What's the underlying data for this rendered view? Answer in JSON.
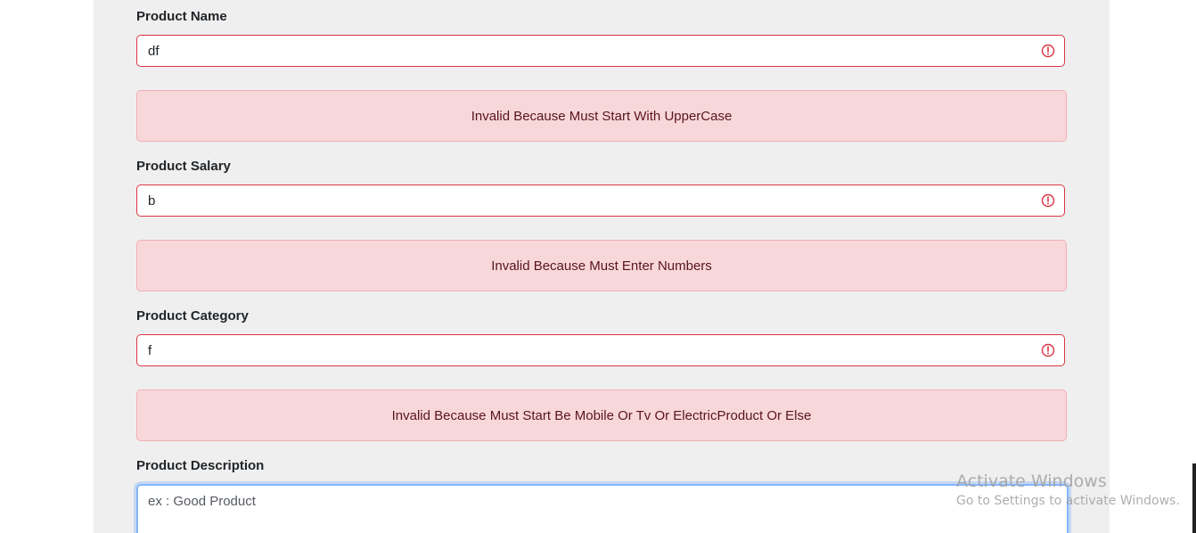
{
  "form": {
    "name": {
      "label": "Product Name",
      "value": "df",
      "error": "Invalid Because Must Start With UpperCase"
    },
    "salary": {
      "label": "Product Salary",
      "value": "b",
      "error": "Invalid Because Must Enter Numbers"
    },
    "category": {
      "label": "Product Category",
      "value": "f",
      "error": "Invalid Because Must Start Be Mobile Or Tv Or ElectricProduct Or Else"
    },
    "description": {
      "label": "Product Description",
      "placeholder": "ex : Good Product"
    }
  },
  "watermark": {
    "title": "Activate Windows",
    "subtitle": "Go to Settings to activate Windows."
  },
  "colors": {
    "error": "#dc3545",
    "alert_bg": "#f8d7da",
    "panel_bg": "#efefef"
  },
  "icons": {
    "error": "exclamation-circle-icon"
  }
}
